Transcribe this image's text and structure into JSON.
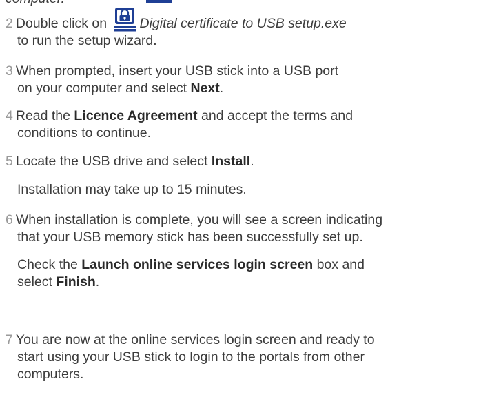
{
  "top": {
    "cut_text": "computer."
  },
  "steps": [
    {
      "number": "2",
      "pre": "Double click on ",
      "icon": "usb-lock-icon",
      "file": "Digital certificate to USB setup.exe",
      "line2": "to run the setup wizard."
    },
    {
      "number": "3",
      "line1": "When prompted, insert your USB stick into a USB port",
      "line2_pre": "on your computer and select ",
      "line2_bold": "Next",
      "line2_post": "."
    },
    {
      "number": "4",
      "line1_pre": "Read the ",
      "line1_bold": "Licence Agreement",
      "line1_post": " and accept the terms and",
      "line2": "conditions to continue."
    },
    {
      "number": "5",
      "line1_pre": "Locate the USB drive and select ",
      "line1_bold": "Install",
      "line1_post": ".",
      "note": "Installation may take up to 15 minutes."
    },
    {
      "number": "6",
      "line1": "When installation is complete, you will see a screen indicating",
      "line2": "that your USB memory stick has been successfully set up.",
      "sub1_pre": "Check the ",
      "sub1_bold": "Launch online services login screen",
      "sub1_post": " box and",
      "sub2_pre": "select ",
      "sub2_bold": "Finish",
      "sub2_post": "."
    },
    {
      "number": "7",
      "line1": "You are now at the online services login screen and ready to",
      "line2": "start using your USB stick to login to the portals from other",
      "line3": "computers."
    }
  ],
  "colors": {
    "text": "#3c3c3c",
    "number": "#9a9a9a",
    "icon_blue": "#1f3f95"
  }
}
